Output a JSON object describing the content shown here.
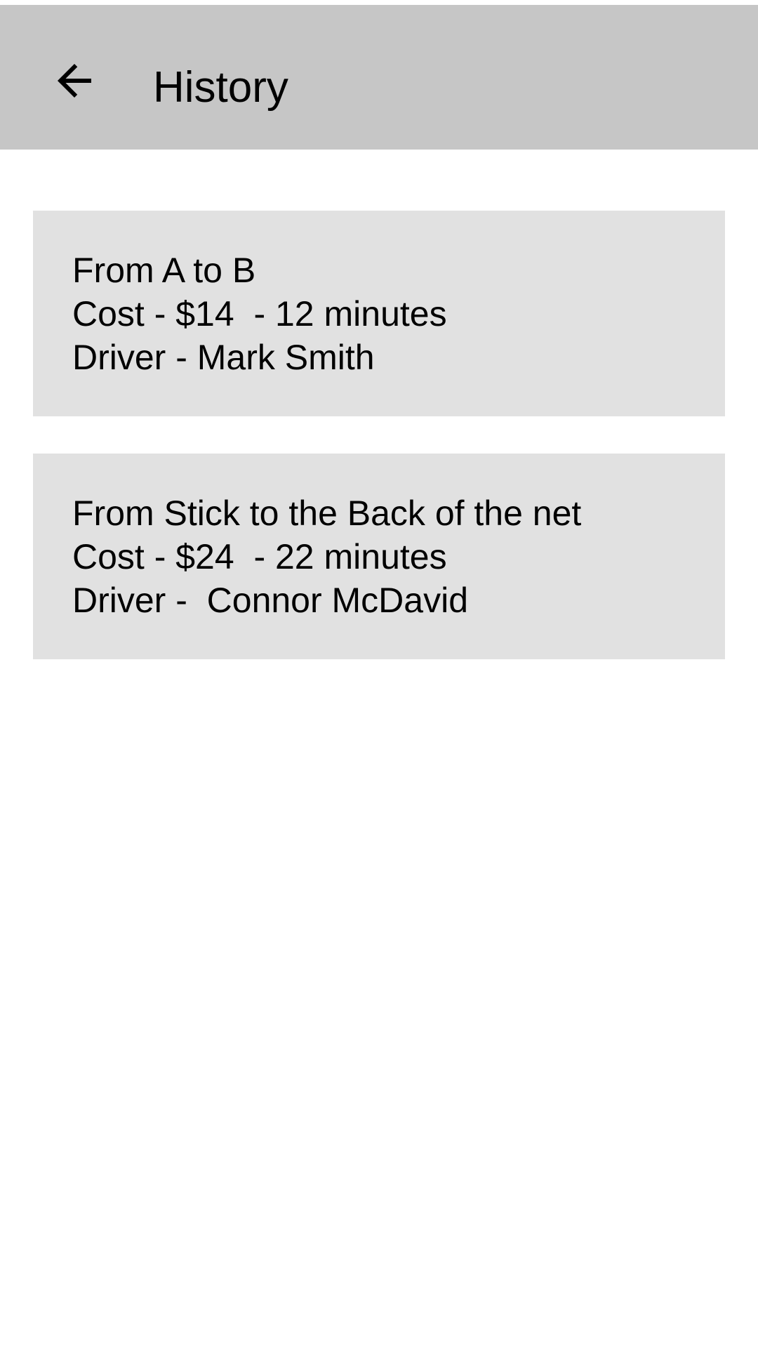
{
  "header": {
    "title": "History",
    "back_icon": "arrow-left-icon",
    "background_color": "#c6c6c6"
  },
  "history": {
    "card_color": "#e1e1e1",
    "items": [
      {
        "route": "From A to B",
        "cost_time": "Cost - $14  - 12 minutes",
        "driver": "Driver - Mark Smith"
      },
      {
        "route": "From Stick to the Back of the net",
        "cost_time": "Cost - $24  - 22 minutes",
        "driver": "Driver -  Connor McDavid"
      }
    ]
  }
}
